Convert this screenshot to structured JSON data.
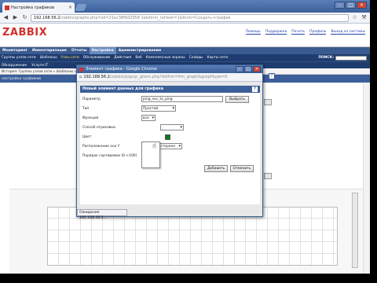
{
  "browser": {
    "tab_title": "Настройка графиков",
    "tab_close": "×",
    "url_host": "192.168.56.2",
    "url_path": "/zabbix/graphs.php?sid=21ec38f6d2958 1e&form_refresh=1&form=Создать+график",
    "window_buttons": [
      "–",
      "□",
      "×"
    ]
  },
  "zabbix": {
    "logo": "ZABBIX",
    "top_links": [
      "Помощь",
      "Поддержка",
      "Печать",
      "Профиль",
      "Выход из системы"
    ],
    "main_menu": [
      "Мониторинг",
      "Инвентаризация",
      "Отчеты",
      "Настройка",
      "Администрирование"
    ],
    "active_menu": "Настройка",
    "submenu": [
      "Группы узлов сети",
      "Шаблоны",
      "Узлы сети",
      "Обслуживание",
      "Действия",
      "Веб",
      "Комплексные экраны",
      "Слайды",
      "Карты сети"
    ],
    "submenu_highlight": "Узлы сети",
    "submenu2": [
      "Обнаружение",
      "Услуги IT"
    ],
    "search_label": "ПОИСК:",
    "breadcrumbs": "История: Группы узлов сети » Шаблоны » Настройка элементов данных » Шаблоны » Настройка графиков",
    "page_bar": "настройка графиков"
  },
  "popup": {
    "title": "Элемент графика - Google Chrome",
    "url_host": "192.168.56.2",
    "url_path": "/zabbix/popup_gitem.php?dstfrm=frm_graph&graphtype=0",
    "window_buttons": [
      "–",
      "□",
      "×"
    ],
    "form_title": "Новый элемент данных для графика",
    "help": "?",
    "fields": {
      "parameter_label": "Параметр",
      "parameter_value": "ping_sec_to_ping",
      "select_button": "Выбрать",
      "type_label": "Тип",
      "type_value": "Простой",
      "function_label": "Функция",
      "function_value": "все",
      "draw_style_label": "Способ отрисовки",
      "color_label": "Цвет",
      "color_value": "#0a7a20",
      "y_axis_label": "Расположение оси Y",
      "y_axis_value": "По левой стороне",
      "sort_label": "Порядок сортировки (0->100)",
      "sort_value": "0"
    },
    "add_button": "Добавить",
    "cancel_button": "Отменить",
    "status": "Ожидание 192.168.56.2..."
  }
}
